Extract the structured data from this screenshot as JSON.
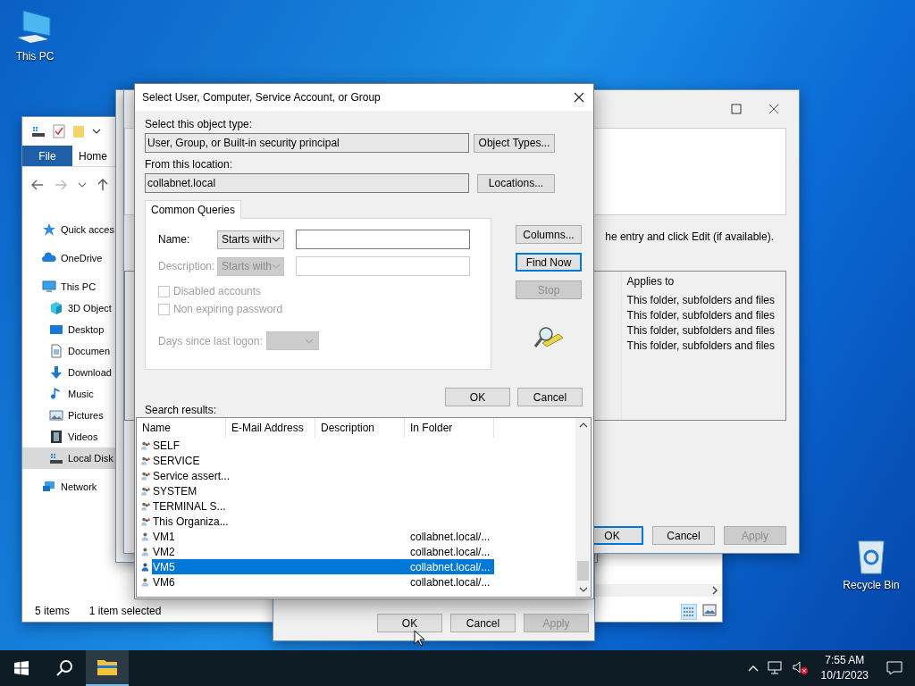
{
  "desktop_icons": [
    {
      "label": "This PC",
      "kind": "computer"
    },
    {
      "label": "Recycle Bin",
      "kind": "bin"
    }
  ],
  "explorer": {
    "ribbon_tabs": [
      {
        "label": "File",
        "selected": true
      },
      {
        "label": "Home",
        "selected": false
      }
    ],
    "nav": [
      {
        "label": "Quick acces",
        "kind": "star",
        "selected": false
      },
      {
        "label": "OneDrive",
        "kind": "cloud",
        "selected": false
      },
      {
        "label": "This PC",
        "kind": "computer",
        "selected": false,
        "children": [
          {
            "label": "3D Object",
            "kind": "cube",
            "selected": false
          },
          {
            "label": "Desktop",
            "kind": "desktop",
            "selected": false
          },
          {
            "label": "Documen",
            "kind": "document",
            "selected": false
          },
          {
            "label": "Download",
            "kind": "download",
            "selected": false
          },
          {
            "label": "Music",
            "kind": "music",
            "selected": false
          },
          {
            "label": "Pictures",
            "kind": "pictures",
            "selected": false
          },
          {
            "label": "Videos",
            "kind": "videos",
            "selected": false
          },
          {
            "label": "Local Disk",
            "kind": "disk",
            "selected": true
          }
        ]
      },
      {
        "label": "Network",
        "kind": "network",
        "selected": false
      }
    ],
    "status": [
      "5 items",
      "1 item selected"
    ]
  },
  "properties": {
    "buttons": [
      {
        "label": "OK",
        "disabled": false
      },
      {
        "label": "Cancel",
        "disabled": false
      },
      {
        "label": "Apply",
        "disabled": true
      }
    ]
  },
  "advanced": {
    "hint": "he entry and click Edit (if available).",
    "column": "Applies to",
    "rows": [
      "This folder, subfolders and files",
      "This folder, subfolders and files",
      "This folder, subfolders and files",
      "This folder, subfolders and files"
    ],
    "buttons": [
      {
        "label": "OK",
        "kind": "default"
      },
      {
        "label": "Cancel",
        "kind": "normal"
      },
      {
        "label": "Apply",
        "kind": "disabled"
      }
    ]
  },
  "dialog": {
    "title": "Select User, Computer, Service Account, or Group",
    "object_type_label": "Select this object type:",
    "object_type": "User, Group, or Built-in security principal",
    "object_types_button": "Object Types...",
    "location_label": "From this location:",
    "location": "collabnet.local",
    "locations_button": "Locations...",
    "tab": "Common Queries",
    "query_rows": [
      {
        "label": "Name:",
        "match": "Starts with",
        "disabled": false
      },
      {
        "label": "Description:",
        "match": "Starts with",
        "disabled": true
      }
    ],
    "checkboxes": [
      {
        "label": "Disabled accounts",
        "checked": false,
        "disabled": true
      },
      {
        "label": "Non expiring password",
        "checked": false,
        "disabled": true
      }
    ],
    "days_label": "Days since last logon:",
    "side_buttons": [
      {
        "label": "Columns...",
        "kind": "normal"
      },
      {
        "label": "Find Now",
        "kind": "default"
      },
      {
        "label": "Stop",
        "kind": "disabled"
      }
    ],
    "buttons": [
      "OK",
      "Cancel"
    ],
    "results_label": "Search results:",
    "columns": [
      "Name",
      "E-Mail Address",
      "Description",
      "In Folder"
    ],
    "results": [
      {
        "name": "SELF",
        "kind": "group",
        "selected": false
      },
      {
        "name": "SERVICE",
        "kind": "group",
        "selected": false
      },
      {
        "name": "Service assert...",
        "kind": "group",
        "selected": false
      },
      {
        "name": "SYSTEM",
        "kind": "group",
        "selected": false
      },
      {
        "name": "TERMINAL S...",
        "kind": "group",
        "selected": false
      },
      {
        "name": "This Organiza...",
        "kind": "group",
        "selected": false
      },
      {
        "name": "VM1",
        "kind": "user",
        "folder": "collabnet.local/...",
        "selected": false
      },
      {
        "name": "VM2",
        "kind": "user",
        "folder": "collabnet.local/...",
        "selected": false
      },
      {
        "name": "VM5",
        "kind": "user",
        "folder": "collabnet.local/...",
        "selected": true
      },
      {
        "name": "VM6",
        "kind": "user",
        "folder": "collabnet.local/...",
        "selected": false
      }
    ]
  },
  "taskbar": {
    "apps": [
      {
        "kind": "explorer",
        "active": true
      }
    ],
    "time": "7:55 AM",
    "date": "10/1/2023"
  }
}
